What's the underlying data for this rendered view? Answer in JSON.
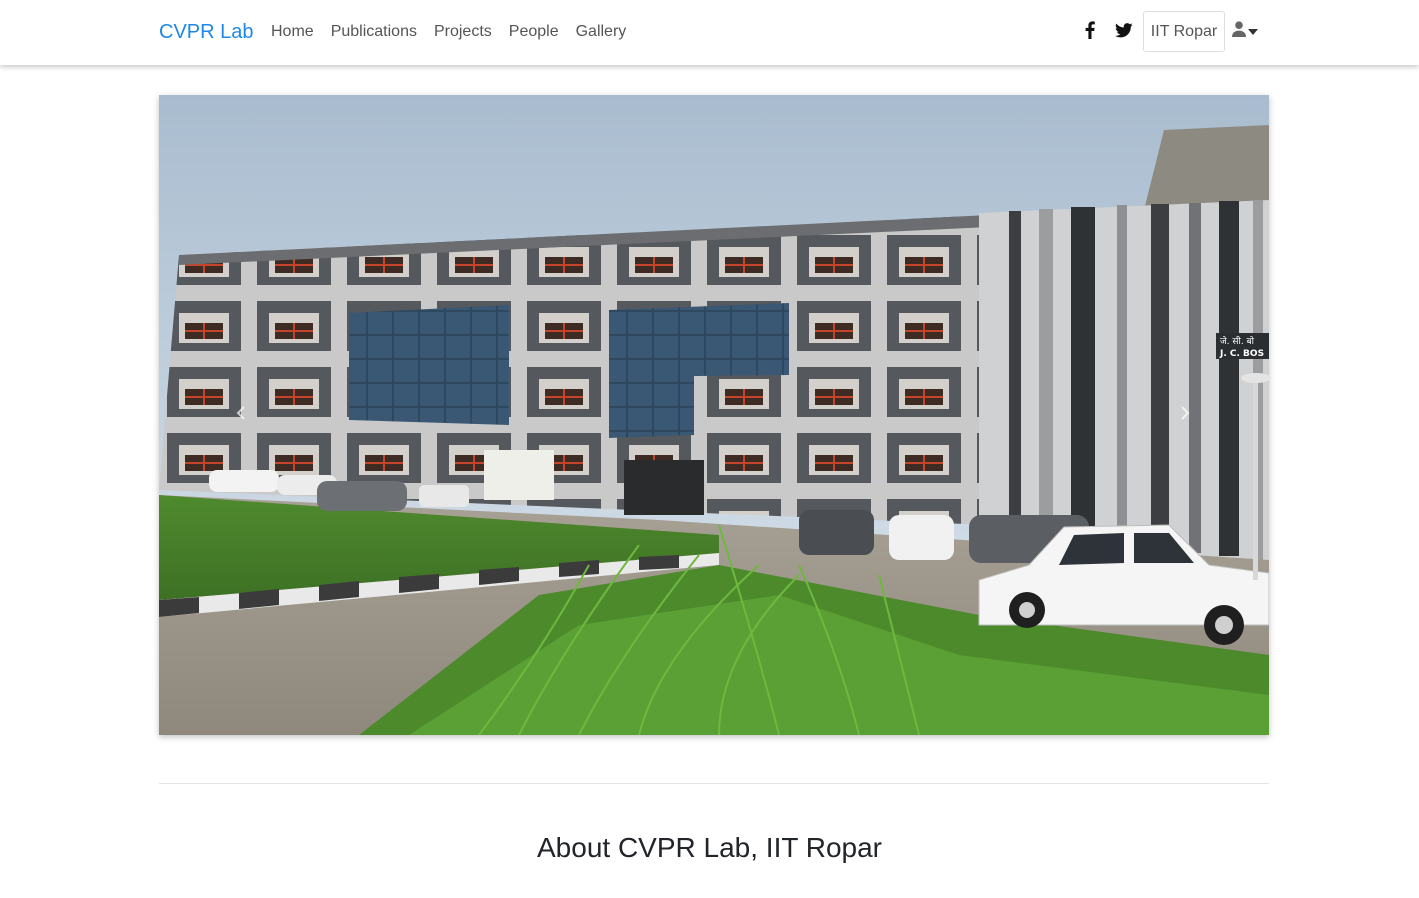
{
  "navbar": {
    "brand": "CVPR Lab",
    "links": [
      "Home",
      "Publications",
      "Projects",
      "People",
      "Gallery"
    ],
    "org_button": "IIT Ropar",
    "icons": {
      "facebook": "facebook-icon",
      "twitter": "twitter-icon",
      "user": "user-icon",
      "caret": "caret-down-icon"
    },
    "brand_color": "#1e88e5"
  },
  "hero": {
    "sign_text_line1": "जे. सी. बो",
    "sign_text_line2": "J. C. BOS"
  },
  "about": {
    "heading": "About CVPR Lab, IIT Ropar"
  }
}
